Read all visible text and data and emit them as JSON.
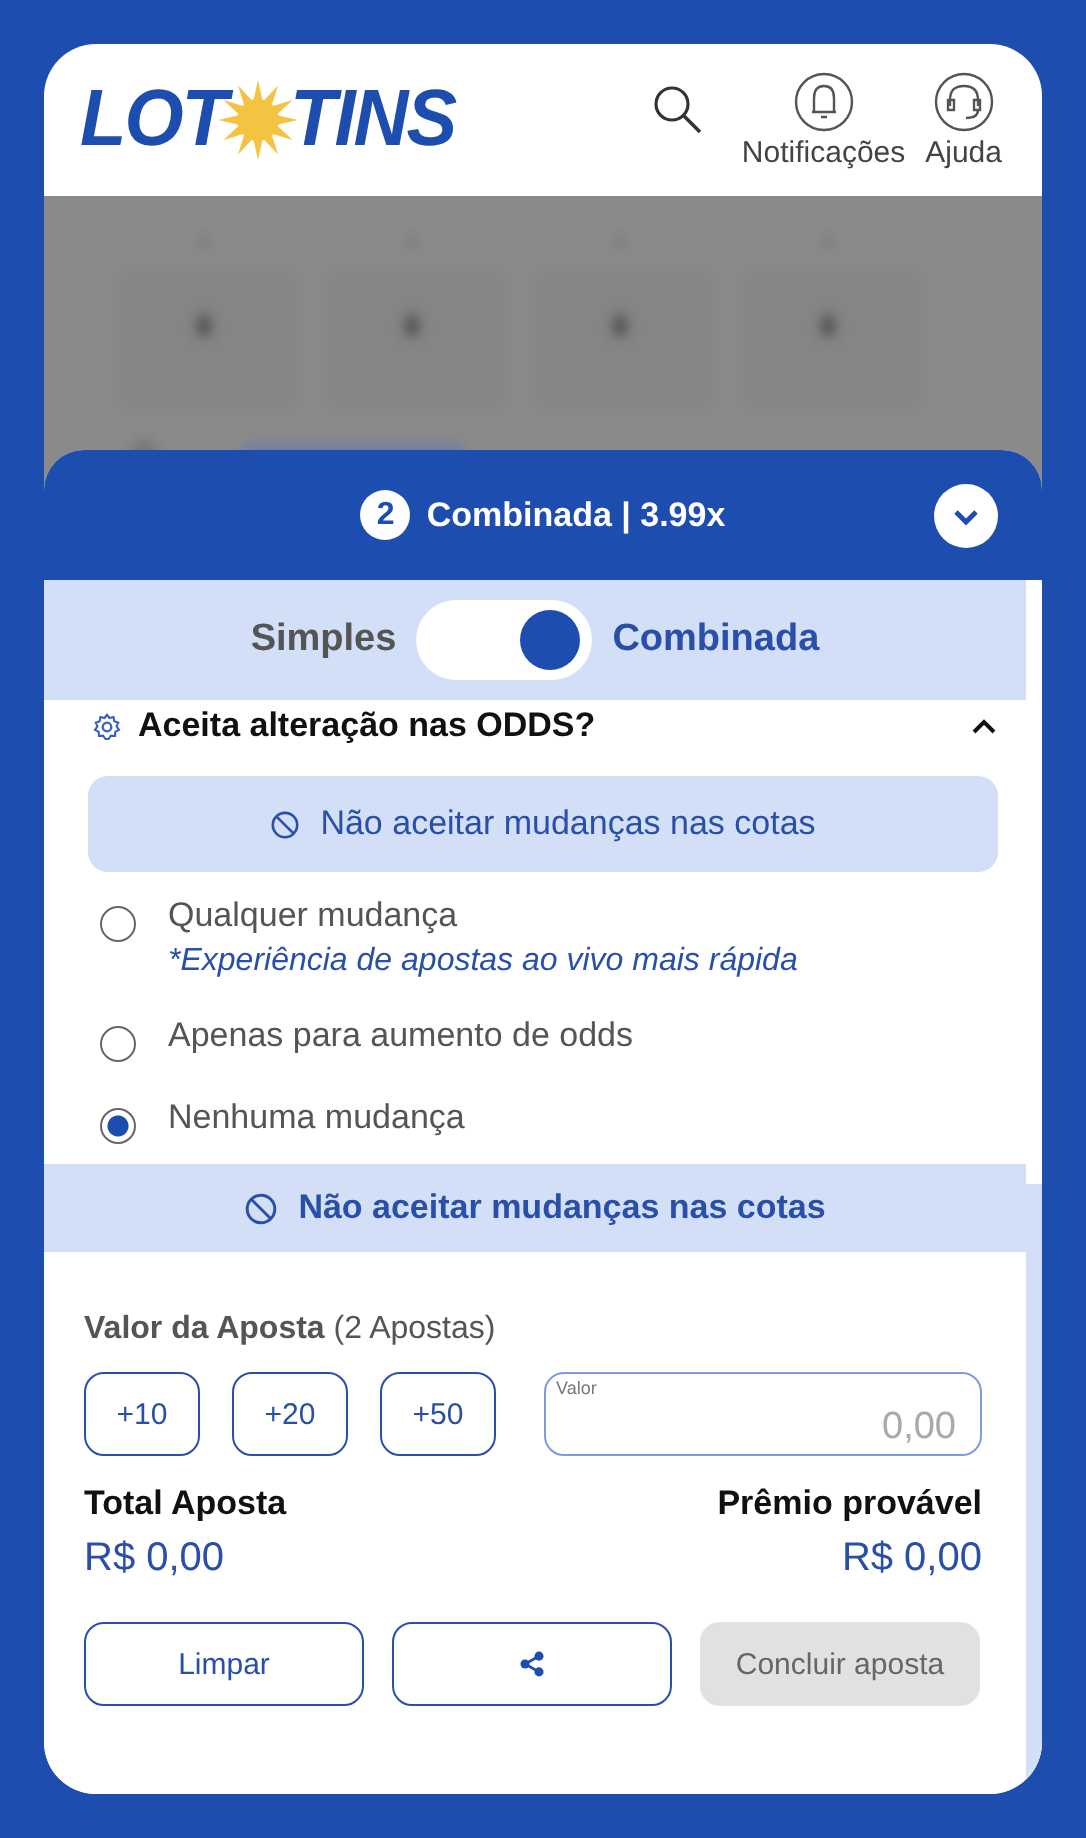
{
  "header": {
    "logo": {
      "left": "LOT",
      "right": "TINS"
    },
    "actions": [
      {
        "kind": "search"
      },
      {
        "kind": "bell",
        "label": "Notificações"
      },
      {
        "kind": "headset",
        "label": "Ajuda"
      }
    ]
  },
  "background": {
    "kind": "blurred"
  },
  "bet_slip": {
    "count": "2",
    "title": "Combinada | 3.99x",
    "expanded": true,
    "modes": [
      {
        "label": "Simples",
        "selected": false
      },
      {
        "label": "Combinada",
        "selected": true
      }
    ],
    "odds": {
      "title": "Aceita alteração nas ODDS?",
      "expanded": true,
      "banner": "Não aceitar mudanças nas cotas",
      "options": [
        {
          "label": "Qualquer mudança",
          "note": "*Experiência de apostas ao vivo mais rápida",
          "selected": false
        },
        {
          "label": "Apenas para aumento de odds",
          "selected": false
        },
        {
          "label": "Nenhuma mudança",
          "selected": true
        }
      ]
    },
    "summary_banner": "Não aceitar mudanças nas cotas",
    "stake": {
      "label": "Valor da Aposta",
      "count": "(2 Apostas)",
      "quick_amounts": [
        "+10",
        "+20",
        "+50"
      ],
      "field": {
        "label": "Valor",
        "placeholder": "0,00"
      }
    },
    "totals": [
      {
        "label": "Total Aposta",
        "value": "R$ 0,00"
      },
      {
        "label": "Prêmio provável",
        "value": "R$ 0,00"
      }
    ],
    "actions": [
      {
        "kind": "text",
        "label": "Limpar",
        "disabled": false
      },
      {
        "kind": "share"
      },
      {
        "kind": "text",
        "label": "Concluir aposta",
        "disabled": true
      }
    ]
  }
}
